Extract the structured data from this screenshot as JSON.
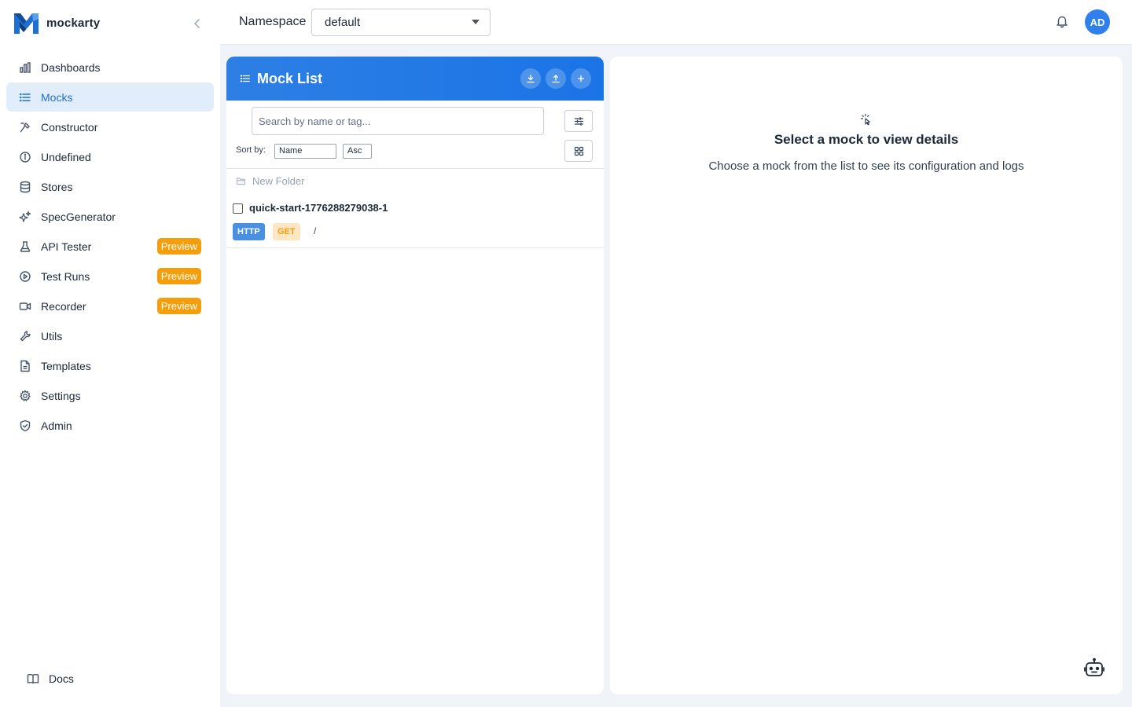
{
  "app": {
    "name": "mockarty"
  },
  "sidebar": {
    "items": [
      {
        "label": "Dashboards",
        "icon": "bar-chart-icon",
        "active": false
      },
      {
        "label": "Mocks",
        "icon": "list-icon",
        "active": true
      },
      {
        "label": "Constructor",
        "icon": "hammer-icon",
        "active": false
      },
      {
        "label": "Undefined",
        "icon": "info-circle-icon",
        "active": false
      },
      {
        "label": "Stores",
        "icon": "database-icon",
        "active": false
      },
      {
        "label": "SpecGenerator",
        "icon": "sparkles-icon",
        "active": false
      },
      {
        "label": "API Tester",
        "icon": "flask-icon",
        "active": false,
        "badge": "Preview"
      },
      {
        "label": "Test Runs",
        "icon": "play-circle-icon",
        "active": false,
        "badge": "Preview"
      },
      {
        "label": "Recorder",
        "icon": "video-icon",
        "active": false,
        "badge": "Preview"
      },
      {
        "label": "Utils",
        "icon": "wrench-icon",
        "active": false
      },
      {
        "label": "Templates",
        "icon": "file-text-icon",
        "active": false
      },
      {
        "label": "Settings",
        "icon": "gear-icon",
        "active": false
      },
      {
        "label": "Admin",
        "icon": "shield-icon",
        "active": false
      }
    ],
    "docs_label": "Docs"
  },
  "topbar": {
    "namespace_label": "Namespace",
    "namespace_value": "default",
    "avatar_initials": "AD"
  },
  "mock_list": {
    "title": "Mock List",
    "search_placeholder": "Search by name or tag...",
    "sort_label": "Sort by:",
    "sort_field": "Name",
    "sort_order": "Asc",
    "folder_label": "New Folder",
    "items": [
      {
        "name": "quick-start-1776288279038-1",
        "protocol": "HTTP",
        "method": "GET",
        "path": "/"
      }
    ]
  },
  "details": {
    "title": "Select a mock to view details",
    "subtitle": "Choose a mock from the list to see its configuration and logs"
  },
  "colors": {
    "accent": "#1f6fd1",
    "header_blue": "#2d7fe4",
    "preview_badge": "#f59e0b",
    "active_bg": "#e1edfb"
  }
}
